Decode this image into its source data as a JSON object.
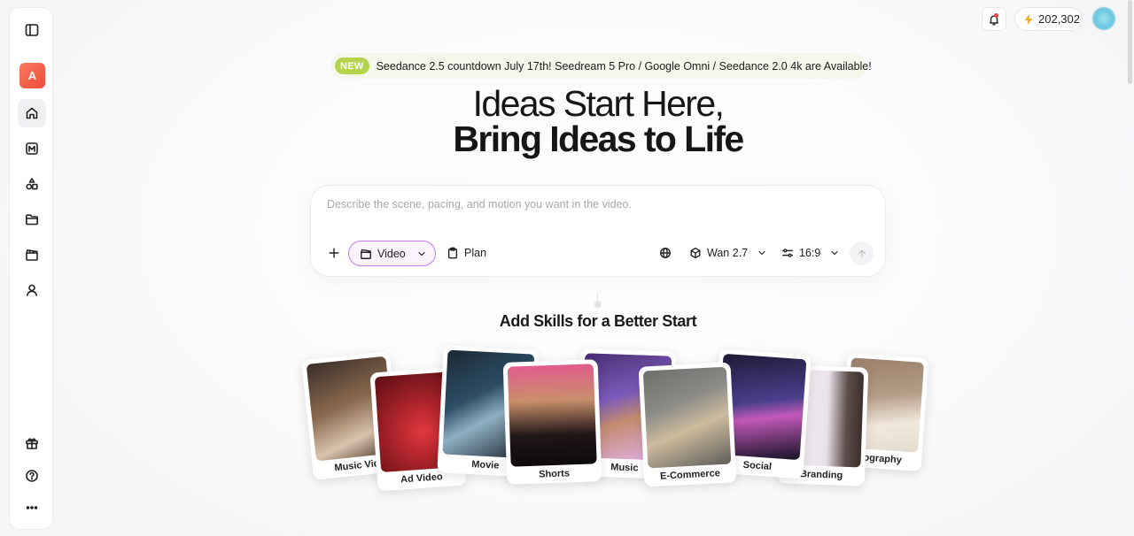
{
  "announcement": {
    "badge": "NEW",
    "text": "Seedance 2.5 countdown July 17th! Seedream 5 Pro / Google Omni / Seedance 2.0 4k are Available!"
  },
  "sidebar": {
    "avatar_letter": "A",
    "items": [
      {
        "icon": "sidebar-toggle-icon"
      },
      {
        "icon": "home-icon",
        "active": true
      },
      {
        "icon": "m-logo-icon"
      },
      {
        "icon": "shapes-icon"
      },
      {
        "icon": "folder-icon"
      },
      {
        "icon": "clapperboard-icon"
      },
      {
        "icon": "user-icon"
      },
      {
        "icon": "gift-icon"
      },
      {
        "icon": "help-icon"
      },
      {
        "icon": "more-icon"
      }
    ]
  },
  "topbar": {
    "credits": "202,302",
    "accent": "#f5a623"
  },
  "hero": {
    "line1": "Ideas Start Here,",
    "line2": "Bring Ideas to Life"
  },
  "prompt": {
    "placeholder": "Describe the scene, pacing, and motion you want in the video.",
    "mode": "Video",
    "plan": "Plan",
    "model": "Wan 2.7",
    "ratio": "16:9"
  },
  "skills": {
    "title": "Add Skills for a Better Start",
    "cards": [
      {
        "label": "Music Vid",
        "bg": "#8b6a4f"
      },
      {
        "label": "Ad Video",
        "bg": "#b3262d"
      },
      {
        "label": "Movie",
        "bg": "#2d4e66"
      },
      {
        "label": "Shorts",
        "bg": "#3a2a2a"
      },
      {
        "label": "Music",
        "bg": "#7b5bb8"
      },
      {
        "label": "E-Commerce",
        "bg": "#8a8a86"
      },
      {
        "label": "Social",
        "bg": "#4a3f8c"
      },
      {
        "label": "Branding",
        "bg": "#e9e2ea"
      },
      {
        "label": "tography",
        "bg": "#b49c86"
      }
    ]
  }
}
